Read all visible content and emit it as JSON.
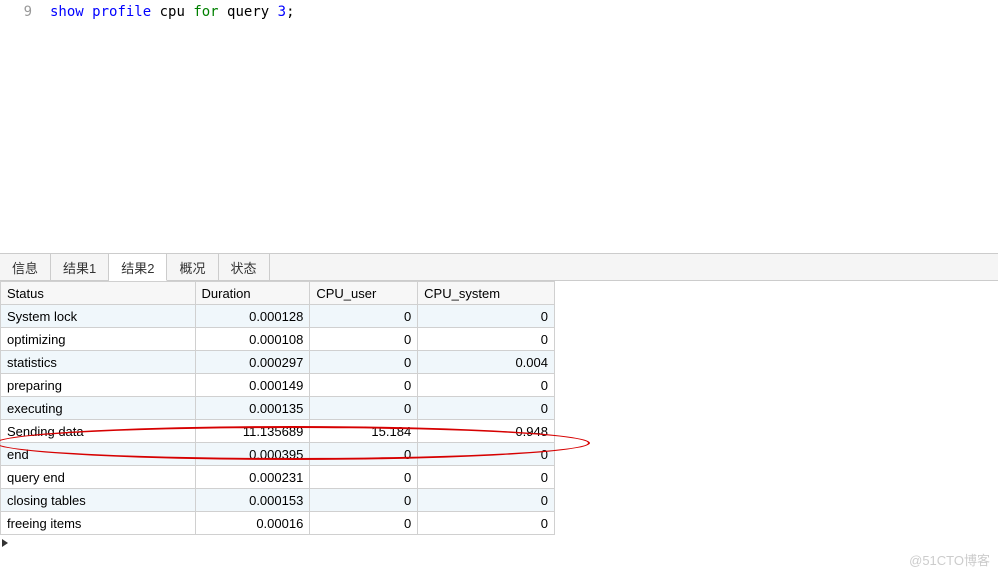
{
  "editor": {
    "lineno": "9",
    "tokens": [
      {
        "text": "show",
        "cls": "kw-blue"
      },
      {
        "text": "  ",
        "cls": "kw-black"
      },
      {
        "text": "profile",
        "cls": "kw-blue"
      },
      {
        "text": " cpu ",
        "cls": "kw-black"
      },
      {
        "text": "for",
        "cls": "kw-green"
      },
      {
        "text": " query ",
        "cls": "kw-black"
      },
      {
        "text": "3",
        "cls": "kw-blue"
      },
      {
        "text": ";",
        "cls": "kw-black"
      }
    ]
  },
  "tabs": [
    {
      "label": "信息",
      "active": false
    },
    {
      "label": "结果1",
      "active": false
    },
    {
      "label": "结果2",
      "active": true
    },
    {
      "label": "概况",
      "active": false
    },
    {
      "label": "状态",
      "active": false
    }
  ],
  "table": {
    "columns": [
      "Status",
      "Duration",
      "CPU_user",
      "CPU_system"
    ],
    "rows": [
      {
        "status": "System lock",
        "duration": "0.000128",
        "cpu_user": "0",
        "cpu_system": "0"
      },
      {
        "status": "optimizing",
        "duration": "0.000108",
        "cpu_user": "0",
        "cpu_system": "0"
      },
      {
        "status": "statistics",
        "duration": "0.000297",
        "cpu_user": "0",
        "cpu_system": "0.004"
      },
      {
        "status": "preparing",
        "duration": "0.000149",
        "cpu_user": "0",
        "cpu_system": "0"
      },
      {
        "status": "executing",
        "duration": "0.000135",
        "cpu_user": "0",
        "cpu_system": "0"
      },
      {
        "status": "Sending data",
        "duration": "11.135689",
        "cpu_user": "15.184",
        "cpu_system": "0.948"
      },
      {
        "status": "end",
        "duration": "0.000395",
        "cpu_user": "0",
        "cpu_system": "0"
      },
      {
        "status": "query end",
        "duration": "0.000231",
        "cpu_user": "0",
        "cpu_system": "0"
      },
      {
        "status": "closing tables",
        "duration": "0.000153",
        "cpu_user": "0",
        "cpu_system": "0"
      },
      {
        "status": "freeing items",
        "duration": "0.00016",
        "cpu_user": "0",
        "cpu_system": "0"
      }
    ],
    "current_row_index": 9
  },
  "annotation": {
    "highlighted_row_index": 5
  },
  "watermark": "@51CTO博客"
}
